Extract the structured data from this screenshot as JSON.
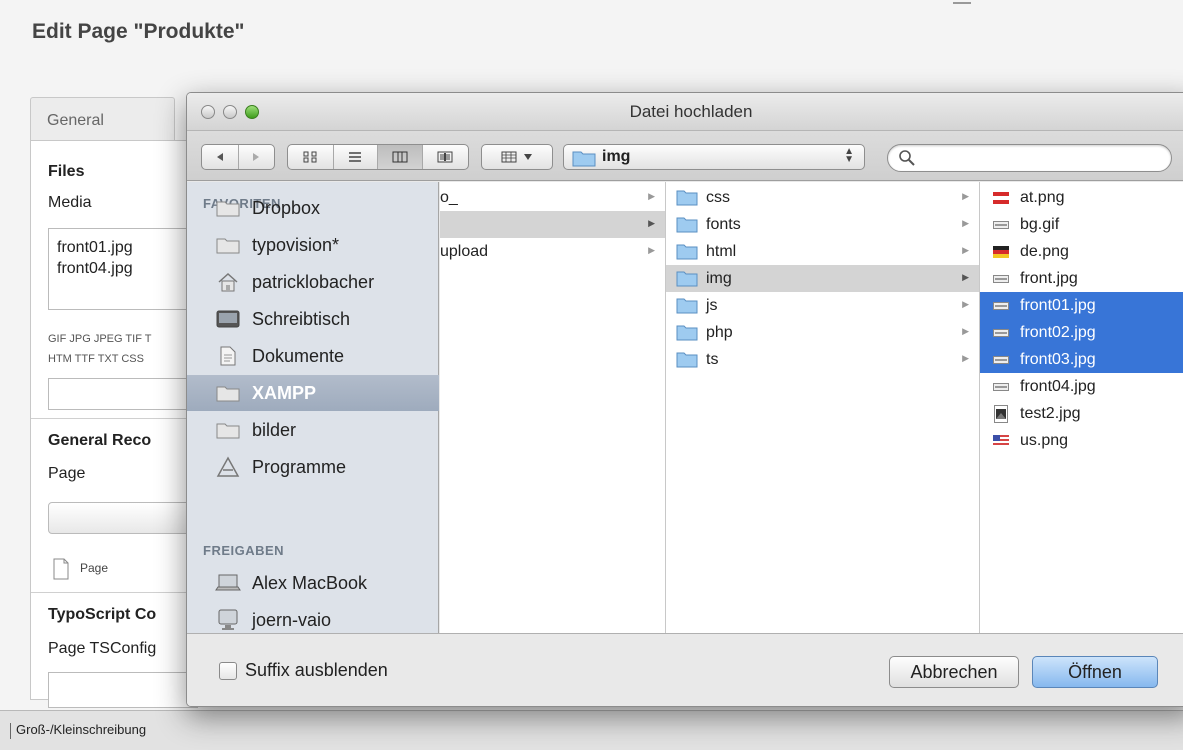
{
  "background": {
    "page_title": "Edit Page \"Produkte\"",
    "tab_general": "General",
    "section_files": "Files",
    "label_media": "Media",
    "media_files": [
      "front01.jpg",
      "front04.jpg"
    ],
    "allowed_types_line1": "GIF JPG JPEG TIF T",
    "allowed_types_line2": "HTM TTF TXT CSS",
    "section_general_records": "General Reco",
    "label_page": "Page",
    "page_icon_label": "Page",
    "section_typoscript": "TypoScript Co",
    "label_page_tsconfig": "Page TSConfig",
    "statusbar_text": "Groß-/Kleinschreibung"
  },
  "dialog": {
    "title": "Datei hochladen",
    "path_label": "img",
    "search_placeholder": "",
    "sidebar": {
      "favorites_header": "FAVORITEN",
      "shared_header": "FREIGABEN",
      "favorites": [
        {
          "label": "Dropbox",
          "icon": "folder-icon"
        },
        {
          "label": "typovision*",
          "icon": "folder-icon"
        },
        {
          "label": "patricklobacher",
          "icon": "home-icon"
        },
        {
          "label": "Schreibtisch",
          "icon": "desktop-icon"
        },
        {
          "label": "Dokumente",
          "icon": "documents-icon"
        },
        {
          "label": "XAMPP",
          "icon": "folder-icon",
          "selected": true
        },
        {
          "label": "bilder",
          "icon": "folder-icon"
        },
        {
          "label": "Programme",
          "icon": "applications-icon"
        }
      ],
      "shared": [
        {
          "label": "Alex MacBook",
          "icon": "laptop-icon"
        },
        {
          "label": "joern-vaio",
          "icon": "computer-icon"
        }
      ]
    },
    "column1": [
      {
        "label": "o_",
        "has_children": true,
        "selected": false
      },
      {
        "label": "",
        "has_children": true,
        "selected": true
      },
      {
        "label": "upload",
        "has_children": true,
        "selected": false
      }
    ],
    "column2": [
      {
        "label": "css",
        "selected": false
      },
      {
        "label": "fonts",
        "selected": false
      },
      {
        "label": "html",
        "selected": false
      },
      {
        "label": "img",
        "selected": true
      },
      {
        "label": "js",
        "selected": false
      },
      {
        "label": "php",
        "selected": false
      },
      {
        "label": "ts",
        "selected": false
      }
    ],
    "column3": [
      {
        "label": "at.png",
        "icon": "flag-at-icon",
        "selected": false
      },
      {
        "label": "bg.gif",
        "icon": "image-thumb-icon",
        "selected": false
      },
      {
        "label": "de.png",
        "icon": "flag-de-icon",
        "selected": false
      },
      {
        "label": "front.jpg",
        "icon": "image-thumb-icon",
        "selected": false
      },
      {
        "label": "front01.jpg",
        "icon": "image-thumb-icon",
        "selected": true
      },
      {
        "label": "front02.jpg",
        "icon": "image-thumb-icon",
        "selected": true
      },
      {
        "label": "front03.jpg",
        "icon": "image-thumb-icon",
        "selected": true
      },
      {
        "label": "front04.jpg",
        "icon": "image-thumb-icon",
        "selected": false
      },
      {
        "label": "test2.jpg",
        "icon": "photo-thumb-icon",
        "selected": false
      },
      {
        "label": "us.png",
        "icon": "flag-us-icon",
        "selected": false
      }
    ],
    "footer": {
      "suffix_label": "Suffix ausblenden",
      "cancel_label": "Abbrechen",
      "open_label": "Öffnen"
    }
  },
  "colors": {
    "selection_blue": "#3875d7",
    "sidebar_bg": "#dde2e9",
    "sidebar_selected": "#a4b0c1",
    "default_button": "#86b8ee"
  }
}
